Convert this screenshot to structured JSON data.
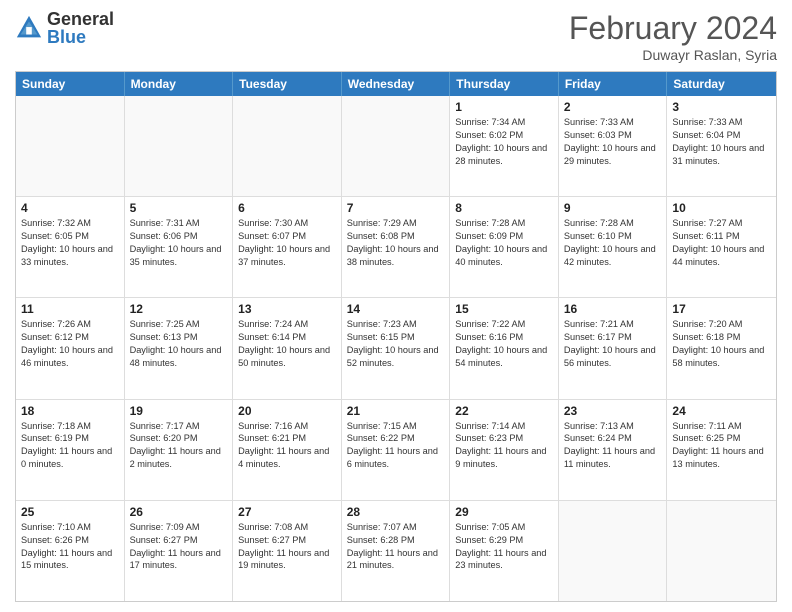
{
  "logo": {
    "general": "General",
    "blue": "Blue"
  },
  "title": "February 2024",
  "location": "Duwayr Raslan, Syria",
  "days_of_week": [
    "Sunday",
    "Monday",
    "Tuesday",
    "Wednesday",
    "Thursday",
    "Friday",
    "Saturday"
  ],
  "weeks": [
    [
      {
        "day": "",
        "info": ""
      },
      {
        "day": "",
        "info": ""
      },
      {
        "day": "",
        "info": ""
      },
      {
        "day": "",
        "info": ""
      },
      {
        "day": "1",
        "info": "Sunrise: 7:34 AM\nSunset: 6:02 PM\nDaylight: 10 hours and 28 minutes."
      },
      {
        "day": "2",
        "info": "Sunrise: 7:33 AM\nSunset: 6:03 PM\nDaylight: 10 hours and 29 minutes."
      },
      {
        "day": "3",
        "info": "Sunrise: 7:33 AM\nSunset: 6:04 PM\nDaylight: 10 hours and 31 minutes."
      }
    ],
    [
      {
        "day": "4",
        "info": "Sunrise: 7:32 AM\nSunset: 6:05 PM\nDaylight: 10 hours and 33 minutes."
      },
      {
        "day": "5",
        "info": "Sunrise: 7:31 AM\nSunset: 6:06 PM\nDaylight: 10 hours and 35 minutes."
      },
      {
        "day": "6",
        "info": "Sunrise: 7:30 AM\nSunset: 6:07 PM\nDaylight: 10 hours and 37 minutes."
      },
      {
        "day": "7",
        "info": "Sunrise: 7:29 AM\nSunset: 6:08 PM\nDaylight: 10 hours and 38 minutes."
      },
      {
        "day": "8",
        "info": "Sunrise: 7:28 AM\nSunset: 6:09 PM\nDaylight: 10 hours and 40 minutes."
      },
      {
        "day": "9",
        "info": "Sunrise: 7:28 AM\nSunset: 6:10 PM\nDaylight: 10 hours and 42 minutes."
      },
      {
        "day": "10",
        "info": "Sunrise: 7:27 AM\nSunset: 6:11 PM\nDaylight: 10 hours and 44 minutes."
      }
    ],
    [
      {
        "day": "11",
        "info": "Sunrise: 7:26 AM\nSunset: 6:12 PM\nDaylight: 10 hours and 46 minutes."
      },
      {
        "day": "12",
        "info": "Sunrise: 7:25 AM\nSunset: 6:13 PM\nDaylight: 10 hours and 48 minutes."
      },
      {
        "day": "13",
        "info": "Sunrise: 7:24 AM\nSunset: 6:14 PM\nDaylight: 10 hours and 50 minutes."
      },
      {
        "day": "14",
        "info": "Sunrise: 7:23 AM\nSunset: 6:15 PM\nDaylight: 10 hours and 52 minutes."
      },
      {
        "day": "15",
        "info": "Sunrise: 7:22 AM\nSunset: 6:16 PM\nDaylight: 10 hours and 54 minutes."
      },
      {
        "day": "16",
        "info": "Sunrise: 7:21 AM\nSunset: 6:17 PM\nDaylight: 10 hours and 56 minutes."
      },
      {
        "day": "17",
        "info": "Sunrise: 7:20 AM\nSunset: 6:18 PM\nDaylight: 10 hours and 58 minutes."
      }
    ],
    [
      {
        "day": "18",
        "info": "Sunrise: 7:18 AM\nSunset: 6:19 PM\nDaylight: 11 hours and 0 minutes."
      },
      {
        "day": "19",
        "info": "Sunrise: 7:17 AM\nSunset: 6:20 PM\nDaylight: 11 hours and 2 minutes."
      },
      {
        "day": "20",
        "info": "Sunrise: 7:16 AM\nSunset: 6:21 PM\nDaylight: 11 hours and 4 minutes."
      },
      {
        "day": "21",
        "info": "Sunrise: 7:15 AM\nSunset: 6:22 PM\nDaylight: 11 hours and 6 minutes."
      },
      {
        "day": "22",
        "info": "Sunrise: 7:14 AM\nSunset: 6:23 PM\nDaylight: 11 hours and 9 minutes."
      },
      {
        "day": "23",
        "info": "Sunrise: 7:13 AM\nSunset: 6:24 PM\nDaylight: 11 hours and 11 minutes."
      },
      {
        "day": "24",
        "info": "Sunrise: 7:11 AM\nSunset: 6:25 PM\nDaylight: 11 hours and 13 minutes."
      }
    ],
    [
      {
        "day": "25",
        "info": "Sunrise: 7:10 AM\nSunset: 6:26 PM\nDaylight: 11 hours and 15 minutes."
      },
      {
        "day": "26",
        "info": "Sunrise: 7:09 AM\nSunset: 6:27 PM\nDaylight: 11 hours and 17 minutes."
      },
      {
        "day": "27",
        "info": "Sunrise: 7:08 AM\nSunset: 6:27 PM\nDaylight: 11 hours and 19 minutes."
      },
      {
        "day": "28",
        "info": "Sunrise: 7:07 AM\nSunset: 6:28 PM\nDaylight: 11 hours and 21 minutes."
      },
      {
        "day": "29",
        "info": "Sunrise: 7:05 AM\nSunset: 6:29 PM\nDaylight: 11 hours and 23 minutes."
      },
      {
        "day": "",
        "info": ""
      },
      {
        "day": "",
        "info": ""
      }
    ]
  ]
}
